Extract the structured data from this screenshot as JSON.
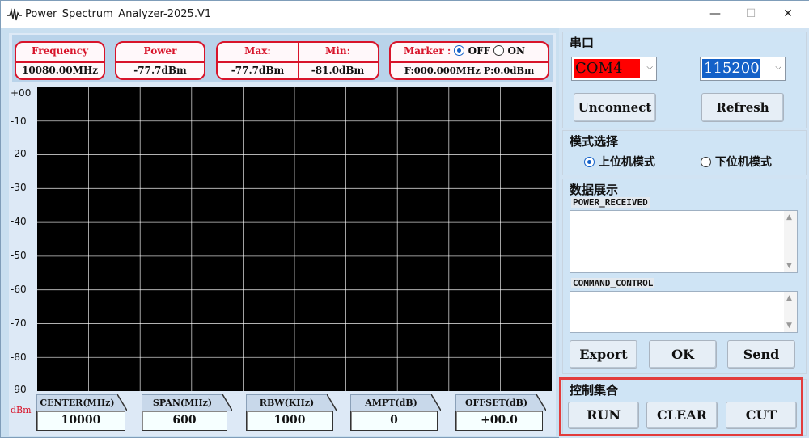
{
  "window": {
    "title": "Power_Spectrum_Analyzer-2025.V1",
    "minimize_symbol": "—",
    "maximize_symbol": "☐",
    "close_symbol": "✕"
  },
  "info": {
    "frequency_label": "Frequency",
    "frequency_value": "10080.00MHz",
    "power_label": "Power",
    "power_value": "-77.7dBm",
    "max_label": "Max:",
    "max_value": "-77.7dBm",
    "min_label": "Min:",
    "min_value": "-81.0dBm",
    "marker_label": "Marker :",
    "marker_off_label": "OFF",
    "marker_on_label": "ON",
    "marker_selected": "OFF",
    "marker_value": "F:000.000MHz P:0.0dBm"
  },
  "plot": {
    "y_ticks": [
      "+00",
      "-10",
      "-20",
      "-30",
      "-40",
      "-50",
      "-60",
      "-70",
      "-80",
      "-90"
    ],
    "y_unit": "dBm",
    "background": "#000000",
    "grid_color": "#ffffff",
    "vertical_divisions": 10
  },
  "params": [
    {
      "label": "CENTER(MHz)",
      "value": "10000"
    },
    {
      "label": "SPAN(MHz)",
      "value": "600"
    },
    {
      "label": "RBW(KHz)",
      "value": "1000"
    },
    {
      "label": "AMPT(dB)",
      "value": "0"
    },
    {
      "label": "OFFSET(dB)",
      "value": "+00.0"
    }
  ],
  "serial": {
    "group_title": "串口",
    "port_value": "COM4",
    "port_bg": "#ff0000",
    "baud_value": "115200",
    "baud_bg": "#1461c8",
    "unconnect_label": "Unconnect",
    "refresh_label": "Refresh"
  },
  "mode": {
    "group_title": "模式选择",
    "upper_label": "上位机模式",
    "lower_label": "下位机模式",
    "selected": "upper"
  },
  "data_display": {
    "group_title": "数据展示",
    "power_received_label": "POWER_RECEIVED",
    "command_control_label": "COMMAND_CONTROL",
    "export_label": "Export",
    "ok_label": "OK",
    "send_label": "Send"
  },
  "control": {
    "group_title": "控制集合",
    "run_label": "RUN",
    "clear_label": "CLEAR",
    "cut_label": "CUT"
  },
  "colors": {
    "accent_red": "#d8142a",
    "highlight_red": "#e23c3c"
  }
}
